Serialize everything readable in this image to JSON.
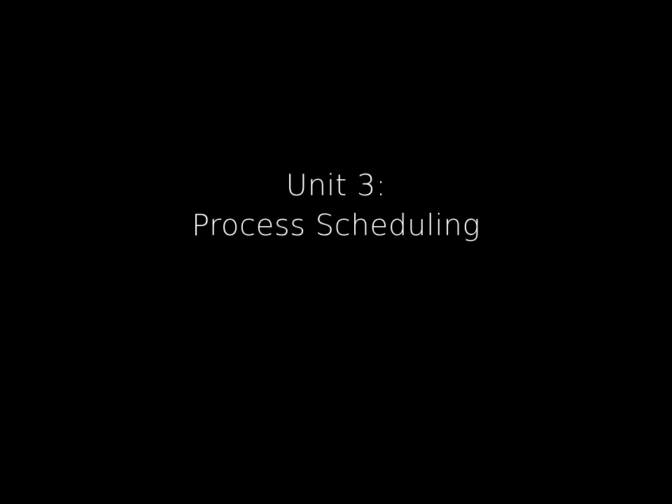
{
  "slide": {
    "title_line_1": "Unit 3:",
    "title_line_2": "Process Scheduling",
    "background_color": "#000000",
    "text_color": "#ffffff"
  }
}
